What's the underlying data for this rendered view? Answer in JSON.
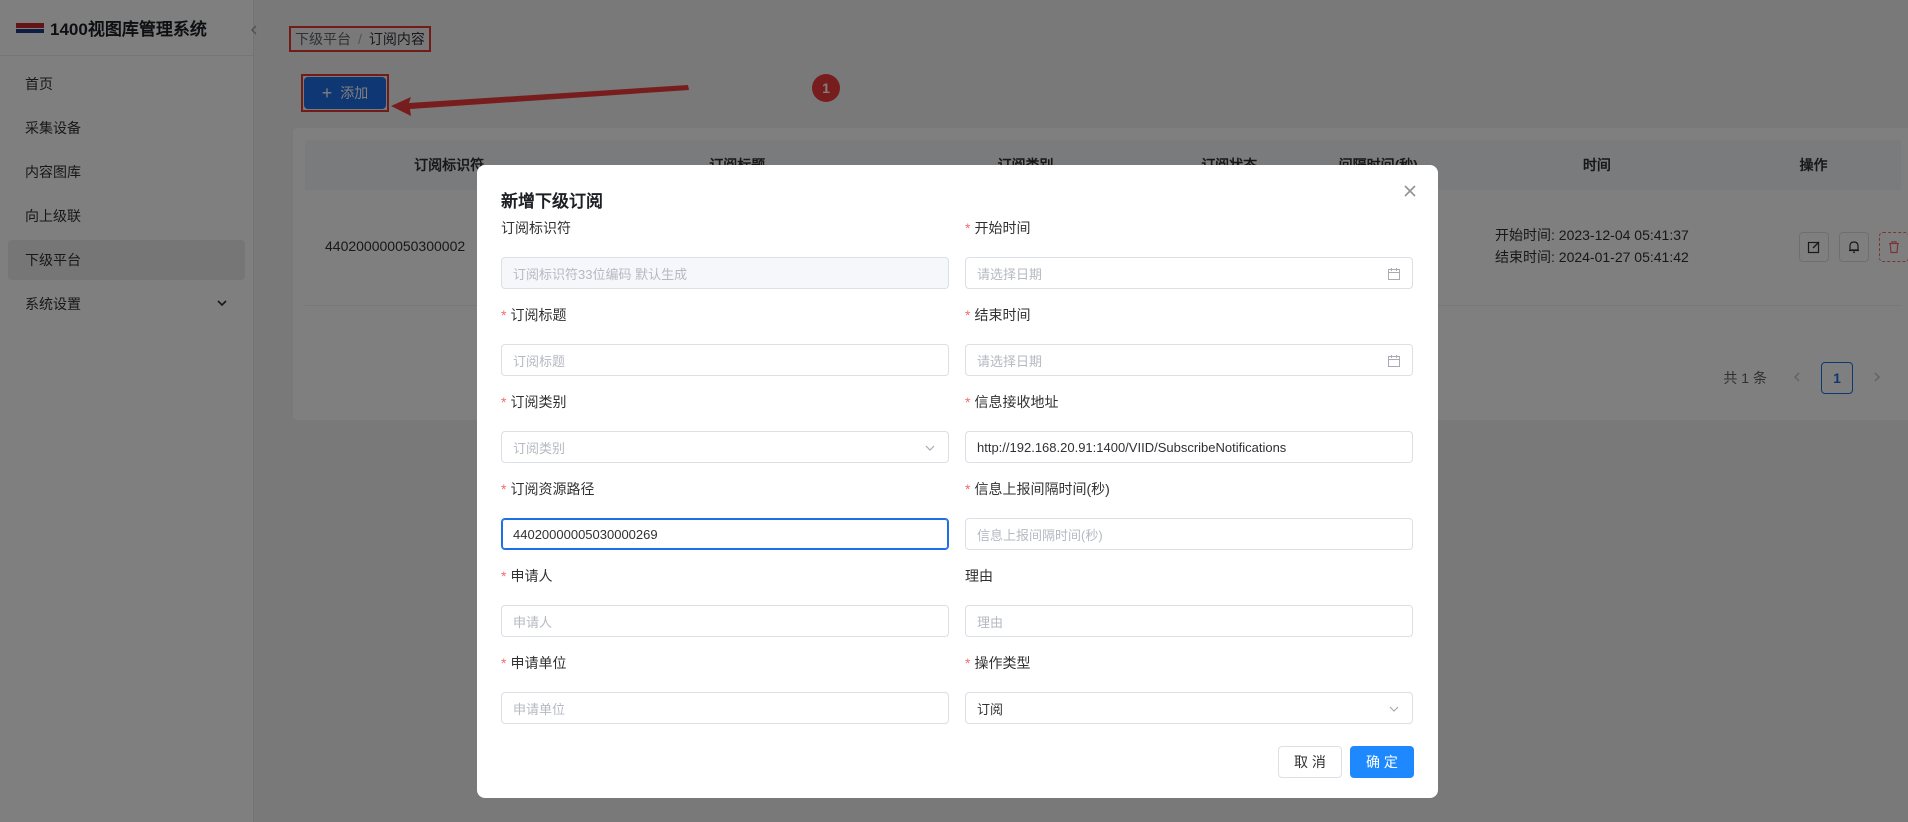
{
  "app": {
    "title": "1400视图库管理系统"
  },
  "sidebar": {
    "items": [
      {
        "label": "首页"
      },
      {
        "label": "采集设备"
      },
      {
        "label": "内容图库"
      },
      {
        "label": "向上级联"
      },
      {
        "label": "下级平台"
      },
      {
        "label": "系统设置"
      }
    ],
    "active": "下级平台"
  },
  "breadcrumb": {
    "parent": "下级平台",
    "separator": "/",
    "current": "订阅内容"
  },
  "toolbar": {
    "add_label": "添加"
  },
  "annotation": {
    "number": "1",
    "color": "#ef3b3b"
  },
  "table": {
    "columns": [
      "订阅标识符",
      "订阅标题",
      "订阅类别",
      "订阅状态",
      "间隔时间(秒)",
      "时间",
      "操作"
    ],
    "row": {
      "id": "440200000050300002",
      "start_time": "开始时间: 2023-12-04 05:41:37",
      "end_time": "结束时间: 2024-01-27 05:41:42"
    }
  },
  "pagination": {
    "total": "共 1 条",
    "current": "1"
  },
  "dialog": {
    "title": "新增下级订阅",
    "fields": {
      "subscribe_id": {
        "label": "订阅标识符",
        "placeholder": "订阅标识符33位编码 默认生成"
      },
      "start_time": {
        "label": "开始时间",
        "placeholder": "请选择日期"
      },
      "sub_title": {
        "label": "订阅标题",
        "placeholder": "订阅标题"
      },
      "end_time": {
        "label": "结束时间",
        "placeholder": "请选择日期"
      },
      "sub_type": {
        "label": "订阅类别",
        "placeholder": "订阅类别"
      },
      "receive_addr": {
        "label": "信息接收地址",
        "value": "http://192.168.20.91:1400/VIID/SubscribeNotifications"
      },
      "resource_path": {
        "label": "订阅资源路径",
        "value": "44020000005030000269"
      },
      "report_interval": {
        "label": "信息上报间隔时间(秒)",
        "placeholder": "信息上报间隔时间(秒)"
      },
      "applicant": {
        "label": "申请人",
        "placeholder": "申请人"
      },
      "reason": {
        "label": "理由",
        "placeholder": "理由"
      },
      "applicant_unit": {
        "label": "申请单位",
        "placeholder": "申请单位"
      },
      "operation_type": {
        "label": "操作类型",
        "value": "订阅"
      }
    },
    "required_mark": "*",
    "cancel_label": "取 消",
    "confirm_label": "确 定"
  },
  "colors": {
    "primary": "#1e6fe6",
    "danger": "#f56c6c",
    "highlight": "#e53935"
  }
}
